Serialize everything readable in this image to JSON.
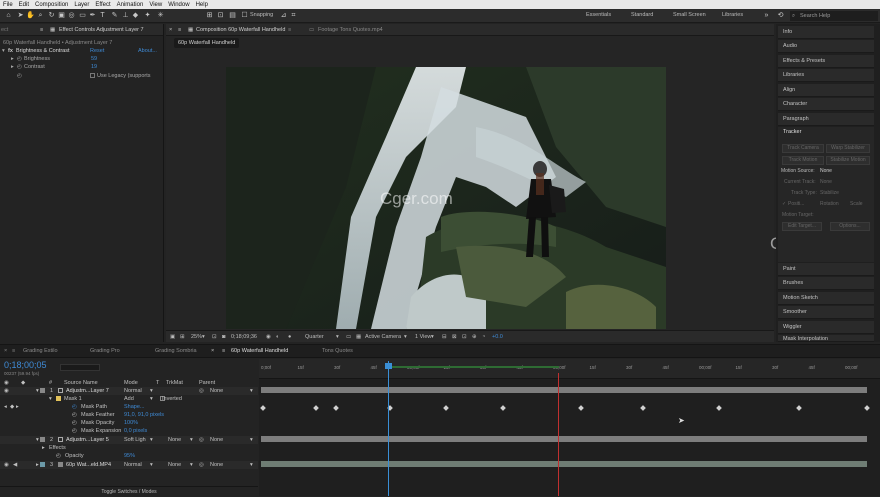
{
  "menu": [
    "File",
    "Edit",
    "Composition",
    "Layer",
    "Effect",
    "Animation",
    "View",
    "Window",
    "Help"
  ],
  "toolbar": {
    "snapping": "Snapping",
    "workspaces": [
      "Essentials",
      "Standard",
      "Small Screen",
      "Libraries"
    ],
    "search": "Search Help"
  },
  "left": {
    "tab": "Effect Controls Adjustment Layer 7",
    "breadcrumb": "60p Waterfall Handheld • Adjustment Layer 7",
    "effect": "Brightness & Contrast",
    "reset": "Reset",
    "about": "About...",
    "brightness_label": "Brightness",
    "brightness_value": "59",
    "contrast_label": "Contrast",
    "contrast_value": "19",
    "legacy_label": "Use Legacy (supports"
  },
  "comp": {
    "tab1": "Composition 60p Waterfall Handheld",
    "tab2": "Footage Tons Quotes.mp4",
    "subtab": "60p Waterfall Handheld",
    "footer": {
      "zoom": "25%",
      "time": "0;18;09;36",
      "res": "Quarter",
      "camera": "Active Camera",
      "view": "1 View",
      "exposure": "+0.0"
    }
  },
  "right": {
    "panels": [
      "Info",
      "Audio",
      "Effects & Presets",
      "Libraries",
      "Align",
      "Character",
      "Paragraph"
    ],
    "tracker": {
      "title": "Tracker",
      "track_camera": "Track Camera",
      "warp": "Warp Stabilizer",
      "track_motion": "Track Motion",
      "stab_motion": "Stabilize Motion",
      "motion_source": "Motion Source:",
      "motion_source_val": "None",
      "current_track": "Current Track:",
      "current_track_val": "None",
      "track_type": "Track Type:",
      "track_type_val": "Stabilize",
      "position": "Positi...",
      "rotation": "Rotation",
      "scale": "Scale",
      "motion_target": "Motion Target:",
      "edit_target": "Edit Target...",
      "options": "Options..."
    },
    "bottom_panels": [
      "Paint",
      "Brushes",
      "Motion Sketch",
      "Smoother",
      "Wiggler",
      "Mask Interpolation"
    ]
  },
  "timeline": {
    "tabs": [
      "Grading Estilo",
      "Grading Pro",
      "Grading Sombria",
      "60p Waterfall Handheld",
      "Tons Quotes"
    ],
    "timecode": "0;18;00;05",
    "fps": "00237 (59.94 fps)",
    "headers": [
      "#",
      "Source Name",
      "Mode",
      "T",
      "TrkMat",
      "Parent"
    ],
    "layers": [
      {
        "num": "1",
        "name": "Adjustm...Layer 7",
        "mode": "Normal",
        "parent": "None"
      },
      {
        "num": "2",
        "name": "Adjustm...Layer 5",
        "mode": "Soft Ligh",
        "trk": "None",
        "parent": "None"
      },
      {
        "num": "3",
        "name": "60p Wat...eld.MP4",
        "mode": "Normal",
        "trk": "None",
        "parent": "None"
      }
    ],
    "mask": {
      "name": "Mask 1",
      "mode": "Add",
      "inverted": "Inverted",
      "path": "Mask Path",
      "path_val": "Shape...",
      "feather": "Mask Feather",
      "feather_val": "91,0, 91,0 pixels",
      "opacity": "Mask Opacity",
      "opacity_val": "100%",
      "expansion": "Mask Expansion",
      "expansion_val": "0,0 pixels"
    },
    "effects": "Effects",
    "opacity": "Opacity",
    "opacity_val": "95%",
    "ruler": [
      "0;00f",
      "15f",
      "30f",
      "45f",
      "00;00f",
      "15f",
      "30f",
      "45f",
      "00;00f",
      "15f",
      "30f",
      "45f",
      "00;00f",
      "15f",
      "30f",
      "45f",
      "00;00f"
    ],
    "footer": "Toggle Switches / Modes"
  },
  "watermark": "Cger.com"
}
